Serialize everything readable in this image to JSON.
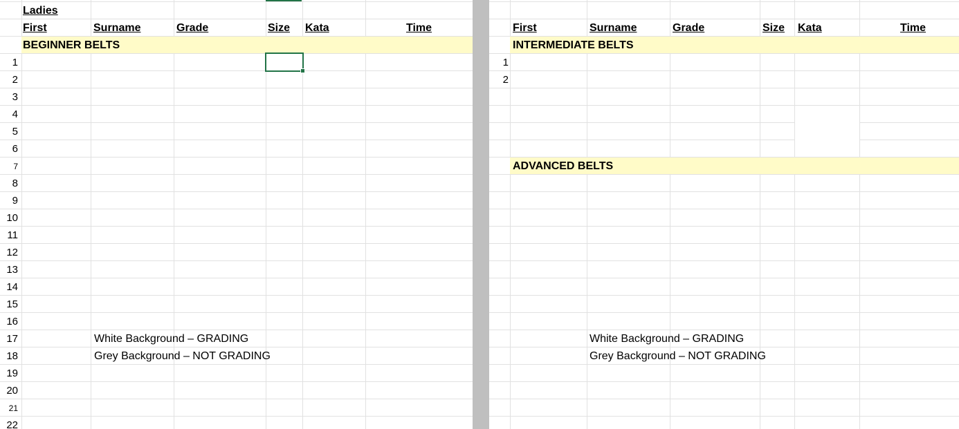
{
  "sheet_title": "Ladies",
  "columns": [
    "First",
    "Surname",
    "Grade",
    "Size",
    "Kata",
    "Time"
  ],
  "left": {
    "section": "BEGINNER BELTS",
    "row_numbers": [
      "1",
      "2",
      "3",
      "4",
      "5",
      "6",
      "7",
      "8",
      "9",
      "10",
      "11",
      "12",
      "13",
      "14",
      "15",
      "16",
      "17",
      "18",
      "19",
      "20",
      "21",
      "22"
    ],
    "legend_white": "White Background –  GRADING",
    "legend_grey": "Grey Background – NOT GRADING"
  },
  "right": {
    "section": "INTERMEDIATE  BELTS",
    "section2": "ADVANCED  BELTS",
    "row_numbers": [
      "1",
      "2"
    ],
    "legend_white": "White Background –  GRADING",
    "legend_grey": "Grey Background – NOT GRADING"
  },
  "colors": {
    "section_band": "#fffbc8",
    "selection": "#217346",
    "pane_divider": "#bfbfbf",
    "gridline": "#e1e1e1"
  }
}
